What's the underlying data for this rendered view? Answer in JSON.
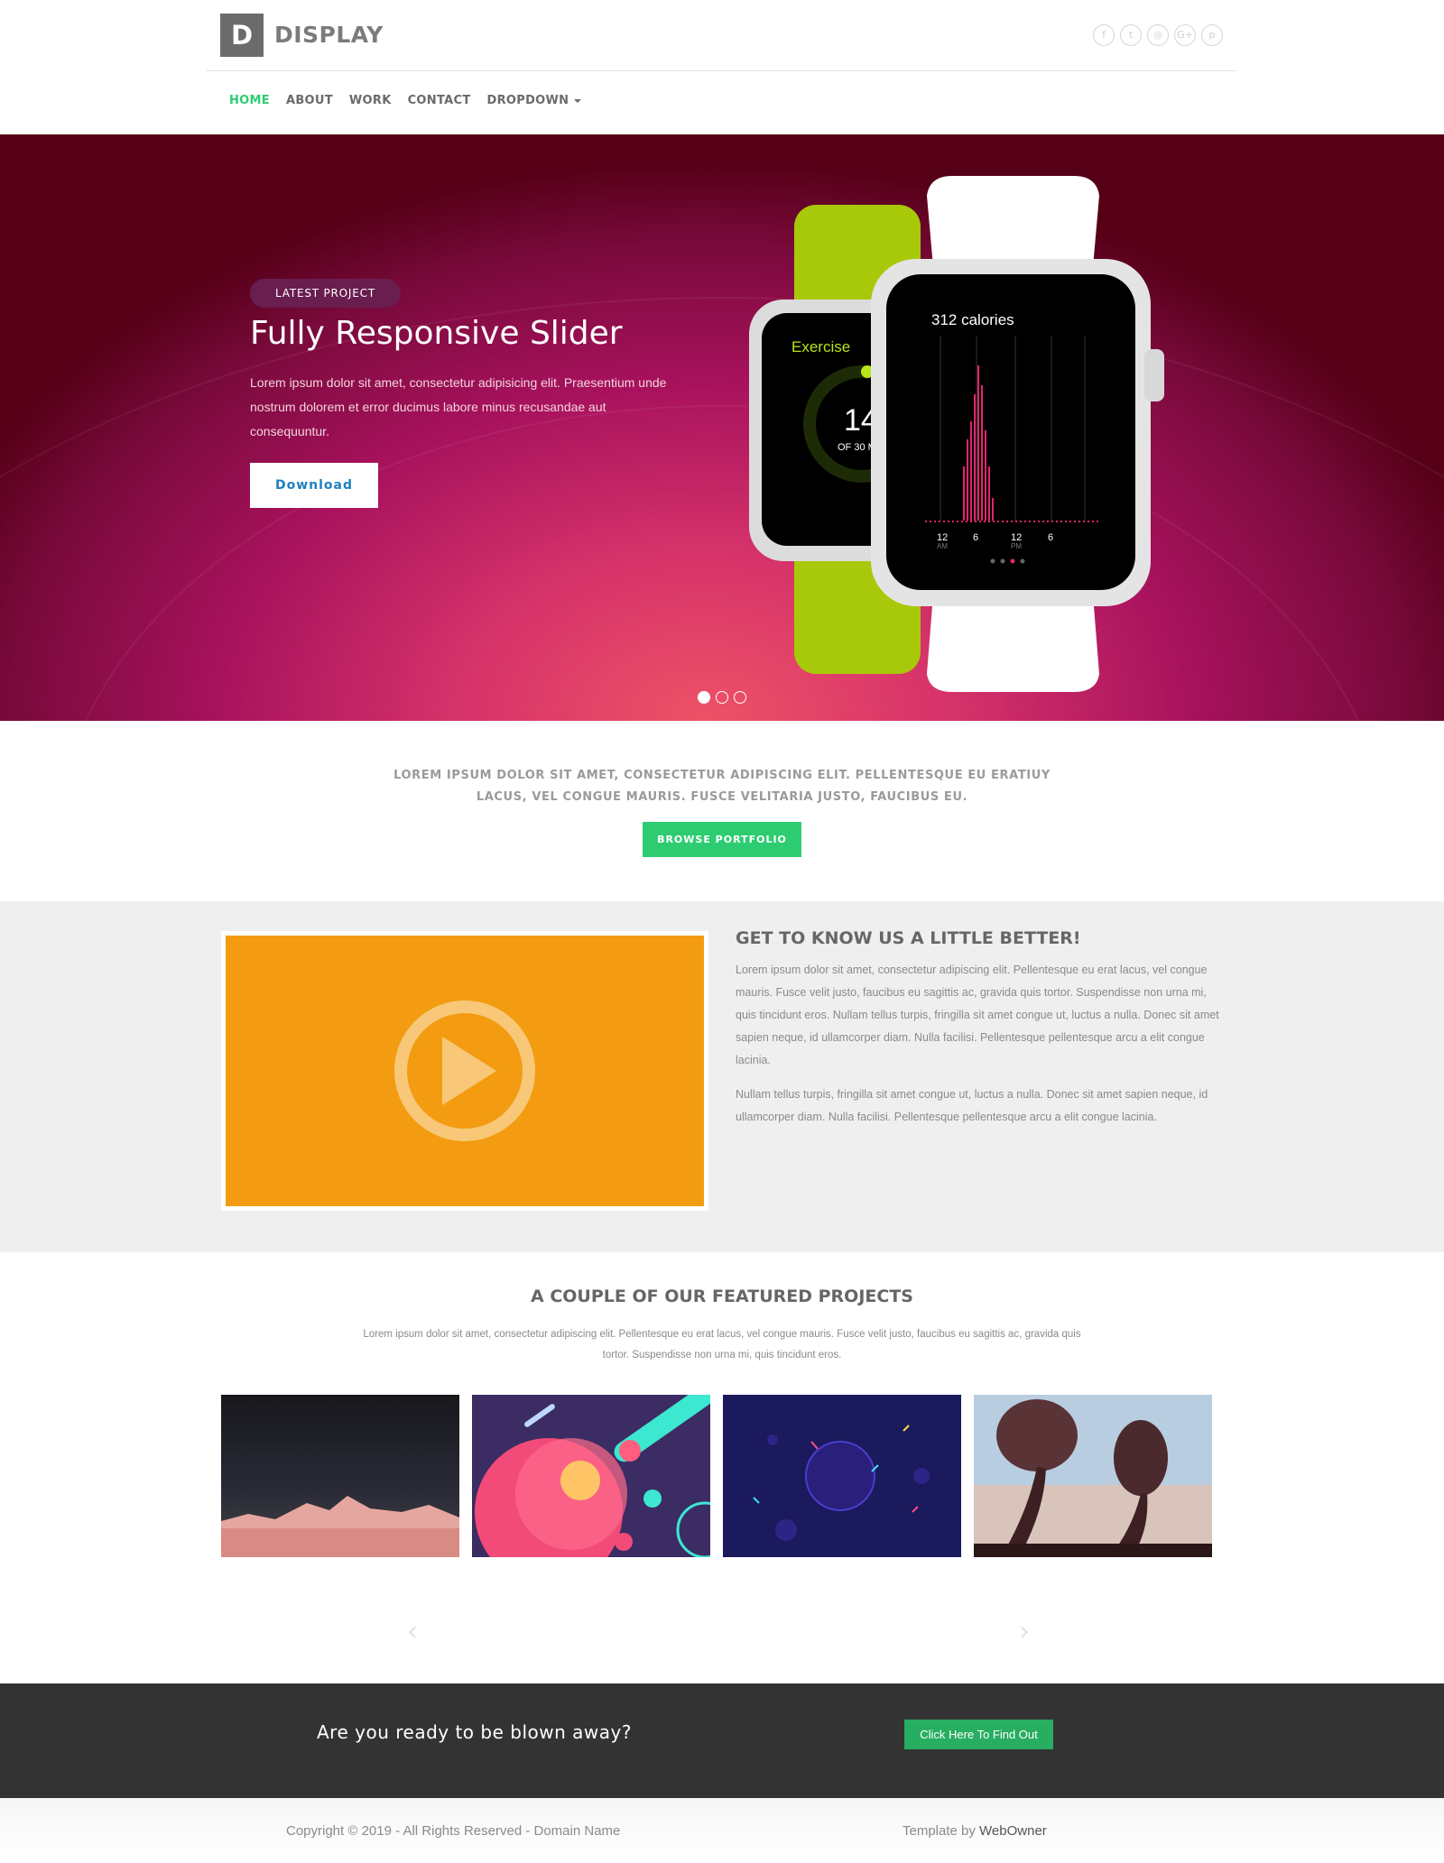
{
  "header": {
    "logo_letter": "D",
    "logo_text": "DISPLAY",
    "social": [
      {
        "icon": "facebook-icon",
        "glyph": "f"
      },
      {
        "icon": "twitter-icon",
        "glyph": "t"
      },
      {
        "icon": "instagram-icon",
        "glyph": "◎"
      },
      {
        "icon": "google-plus-icon",
        "glyph": "G+"
      },
      {
        "icon": "pinterest-icon",
        "glyph": "p"
      }
    ],
    "nav": [
      "HOME",
      "ABOUT",
      "WORK",
      "CONTACT",
      "DROPDOWN"
    ],
    "active_nav": "HOME"
  },
  "hero": {
    "badge": "LATEST PROJECT",
    "title": "Fully Responsive Slider",
    "text": "Lorem ipsum dolor sit amet, consectetur adipisicing elit. Praesentium unde nostrum dolorem et error ducimus labore minus recusandae aut consequuntur.",
    "button": "Download",
    "slide_count": 3,
    "active_slide": 1,
    "watch_left": {
      "label": "Exercise",
      "value": "14",
      "sub": "OF 30 M"
    },
    "watch_right": {
      "label": "312 calories",
      "ticks": [
        "12",
        "6",
        "12",
        "6"
      ],
      "tick_subs": [
        "AM",
        "",
        "PM",
        ""
      ]
    }
  },
  "intro": {
    "text": "LOREM IPSUM DOLOR SIT AMET, CONSECTETUR ADIPISCING ELIT. PELLENTESQUE EU ERATIUY LACUS, VEL CONGUE MAURIS. FUSCE VELITARIA JUSTO, FAUCIBUS EU.",
    "button": "BROWSE PORTFOLIO"
  },
  "about": {
    "title": "GET TO KNOW US A LITTLE BETTER!",
    "p1": "Lorem ipsum dolor sit amet, consectetur adipiscing elit. Pellentesque eu erat lacus, vel congue mauris. Fusce velit justo, faucibus eu sagittis ac, gravida quis tortor. Suspendisse non urna mi, quis tincidunt eros. Nullam tellus turpis, fringilla sit amet congue ut, luctus a nulla. Donec sit amet sapien neque, id ullamcorper diam. Nulla facilisi. Pellentesque pellentesque arcu a elit congue lacinia.",
    "p2": "Nullam tellus turpis, fringilla sit amet congue ut, luctus a nulla. Donec sit amet sapien neque, id ullamcorper diam. Nulla facilisi. Pellentesque pellentesque arcu a elit congue lacinia."
  },
  "featured": {
    "title": "A COUPLE OF OUR FEATURED PROJECTS",
    "text": "Lorem ipsum dolor sit amet, consectetur adipiscing elit. Pellentesque eu erat lacus, vel congue mauris. Fusce velit justo, faucibus eu sagittis ac, gravida quis tortor. Suspendisse non urna mi, quis tincidunt eros."
  },
  "cta": {
    "text": "Are you ready to be blown away?",
    "button": "Click Here To Find Out"
  },
  "footer": {
    "copyright": "Copyright © 2019 - All Rights Reserved - Domain Name",
    "credit_prefix": "Template by ",
    "credit_name": "WebOwner"
  },
  "colors": {
    "accent": "#2ecc71",
    "hero_dark": "#7a0a3c",
    "video_bg": "#f39c12",
    "cta_bg": "#333333"
  }
}
